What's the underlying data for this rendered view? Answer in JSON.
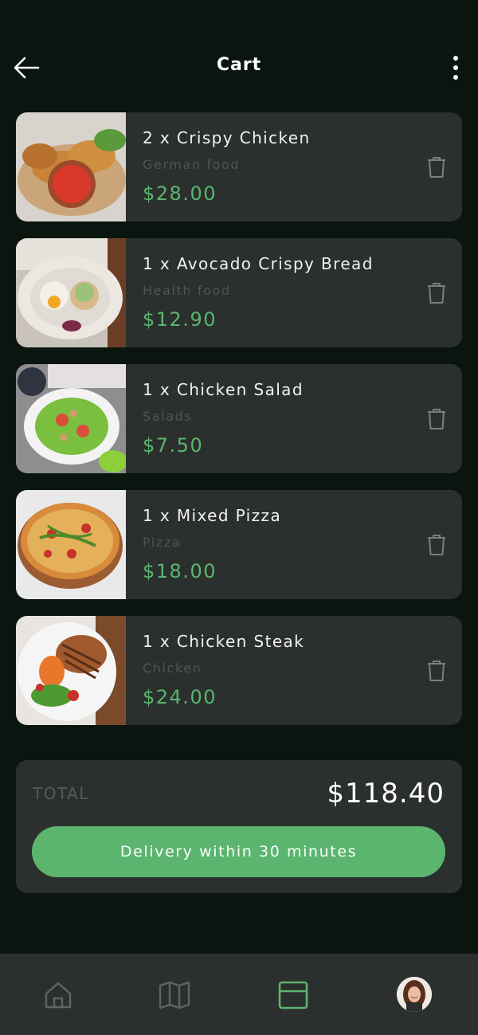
{
  "header": {
    "title": "Cart",
    "back_icon": "arrow-left-icon",
    "menu_icon": "more-vertical-icon"
  },
  "cart": {
    "items": [
      {
        "name": "2 x Crispy Chicken",
        "category": "German food",
        "price": "$28.00",
        "image": "crispy-chicken-image"
      },
      {
        "name": "1 x Avocado Crispy Bread",
        "category": "Health food",
        "price": "$12.90",
        "image": "avocado-bread-image"
      },
      {
        "name": "1 x Chicken Salad",
        "category": "Salads",
        "price": "$7.50",
        "image": "chicken-salad-image"
      },
      {
        "name": "1 x Mixed Pizza",
        "category": "Pizza",
        "price": "$18.00",
        "image": "mixed-pizza-image"
      },
      {
        "name": "1 x Chicken Steak",
        "category": "Chicken",
        "price": "$24.00",
        "image": "chicken-steak-image"
      }
    ]
  },
  "total": {
    "label": "TOTAL",
    "value": "$118.40",
    "button_label": "Delivery within 30 minutes"
  },
  "nav": {
    "items": [
      {
        "icon": "home-icon",
        "active": false
      },
      {
        "icon": "map-icon",
        "active": false
      },
      {
        "icon": "card-icon",
        "active": true
      },
      {
        "icon": "avatar",
        "active": false
      }
    ]
  },
  "colors": {
    "background": "#0a1510",
    "card": "#2b2f2d",
    "accent": "#5cb56f",
    "muted": "#555b58"
  }
}
